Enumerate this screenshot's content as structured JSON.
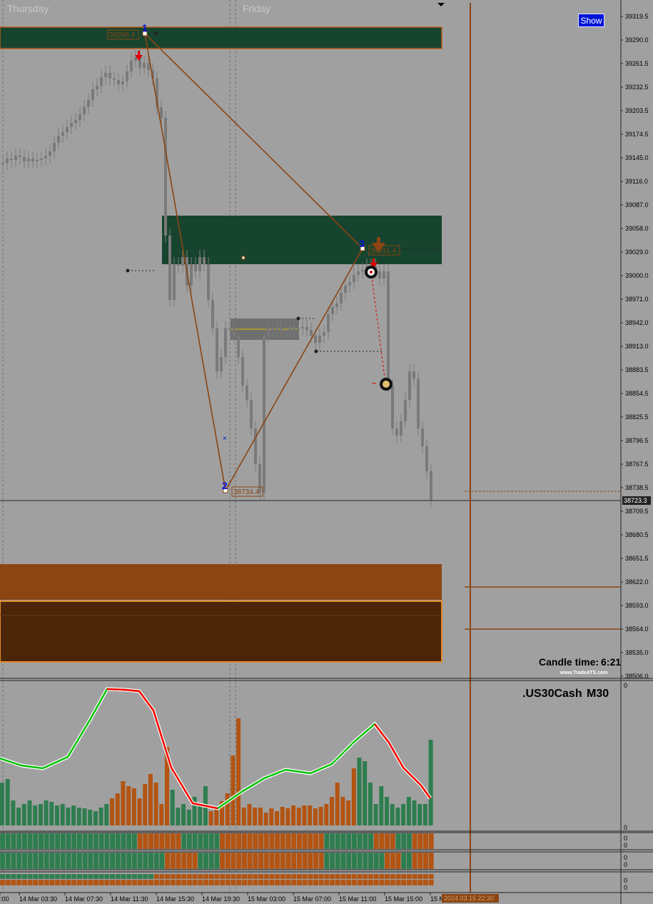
{
  "chart_data": {
    "type": "candlestick",
    "symbol": ".US30Cash",
    "timeframe": "M30",
    "day_labels": [
      "Thursday",
      "Friday"
    ],
    "y_ticks": [
      "39319.5",
      "39290.0",
      "39261.5",
      "39232.5",
      "39203.5",
      "39174.5",
      "39145.0",
      "39116.0",
      "39087.0",
      "39058.0",
      "39029.0",
      "39000.0",
      "38971.0",
      "38942.0",
      "38913.0",
      "38883.5",
      "38854.5",
      "38825.5",
      "38796.5",
      "38767.5",
      "38738.5",
      "38709.5",
      "38680.5",
      "38651.5",
      "38622.0",
      "38593.0",
      "38564.0",
      "38535.0",
      "38506.0"
    ],
    "x_ticks": [
      ":00",
      "14 Mar 03:30",
      "14 Mar 07:30",
      "14 Mar 11:30",
      "14 Mar 15:30",
      "14 Mar 19:30",
      "15 Mar 03:00",
      "15 Mar 07:00",
      "15 Mar 11:00",
      "15 Mar 15:00",
      "15 M"
    ],
    "current_price": "38723.3",
    "cursor_time": "2024.03.15 22:30",
    "candle_time_label": "Candle time:",
    "candle_time_value": "6:21",
    "brand": "www.TradeATS.com",
    "pattern_points": [
      {
        "label": "1",
        "price": "39296.4"
      },
      {
        "label": "2",
        "price": "38734.4"
      },
      {
        "label": "3",
        "price": "39031.4"
      }
    ],
    "zones": [
      {
        "kind": "supply",
        "from": 39263,
        "to": 39300,
        "color": "#17442e"
      },
      {
        "kind": "supply",
        "from": 39015,
        "to": 39070,
        "color": "#17442e"
      },
      {
        "kind": "demand",
        "from": 38597,
        "to": 38645,
        "color": "#8b4513"
      },
      {
        "kind": "demand",
        "from": 38528,
        "to": 38583,
        "color": "#4a2508"
      }
    ],
    "osc_axis": [
      "0",
      "0"
    ],
    "bar_axis": [
      "0",
      "0",
      "0",
      "0",
      "0",
      "0"
    ],
    "colors": {
      "background": "#a0a0a0",
      "candle": "#7a7a7a",
      "supply": "#17442e",
      "demand": "#8b4513",
      "demand_dark": "#4a2508",
      "pattern_line": "#8b4513",
      "osc_up": "#00c000",
      "osc_down": "#ff0000",
      "vol_up": "#2e7d4f",
      "vol_down": "#b35412"
    }
  },
  "ui": {
    "show_button": "Show"
  }
}
